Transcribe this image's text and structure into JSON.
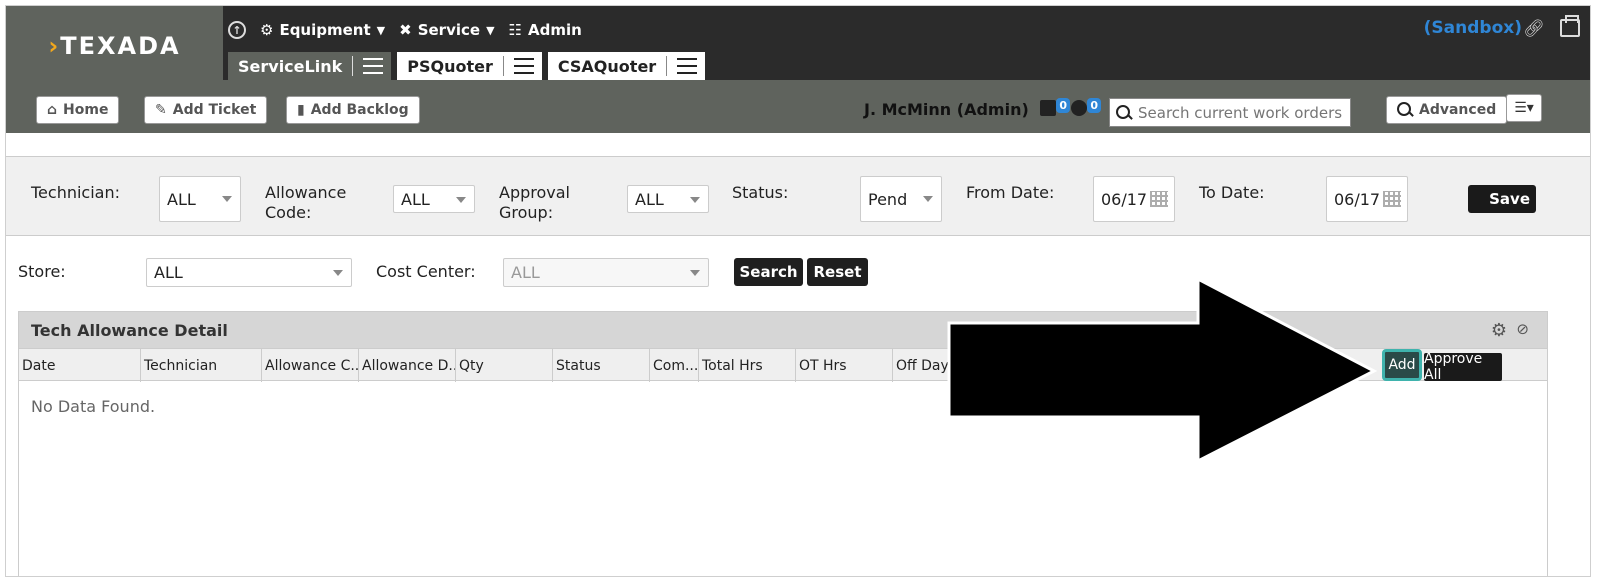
{
  "brand": {
    "logo_text": "TEXADA"
  },
  "top_nav": {
    "equipment": "Equipment",
    "service": "Service",
    "admin": "Admin"
  },
  "tabs": [
    {
      "label": "ServiceLink"
    },
    {
      "label": "PSQuoter"
    },
    {
      "label": "CSAQuoter"
    }
  ],
  "env": {
    "label": "(Sandbox)"
  },
  "toolbar": {
    "home": "Home",
    "add_ticket": "Add Ticket",
    "add_backlog": "Add Backlog",
    "user": "J. McMinn (Admin)",
    "badge1": "0",
    "badge2": "0",
    "search_placeholder": "Search current work orders",
    "advanced": "Advanced"
  },
  "filters": {
    "technician_label": "Technician:",
    "technician_value": "ALL",
    "allowance_label": "Allowance Code:",
    "allowance_value": "ALL",
    "approval_label": "Approval Group:",
    "approval_value": "ALL",
    "status_label": "Status:",
    "status_value": "Pend",
    "from_label": "From Date:",
    "from_value": "06/17",
    "to_label": "To Date:",
    "to_value": "06/17",
    "save": "Save",
    "store_label": "Store:",
    "store_value": "ALL",
    "cost_center_label": "Cost Center:",
    "cost_center_value": "ALL",
    "search": "Search",
    "reset": "Reset"
  },
  "grid": {
    "title": "Tech Allowance Detail",
    "columns": [
      "Date",
      "Technician",
      "Allowance C...",
      "Allowance D...",
      "Qty",
      "Status",
      "Com...",
      "Total Hrs",
      "OT Hrs",
      "Off Day"
    ],
    "add": "Add",
    "approve_all": "Approve All",
    "empty": "No Data Found."
  },
  "colors": {
    "accent": "#2f86d6",
    "header_dark": "#2b2b2b",
    "header_gray": "#5f635d",
    "highlight": "#3fb3ad"
  }
}
